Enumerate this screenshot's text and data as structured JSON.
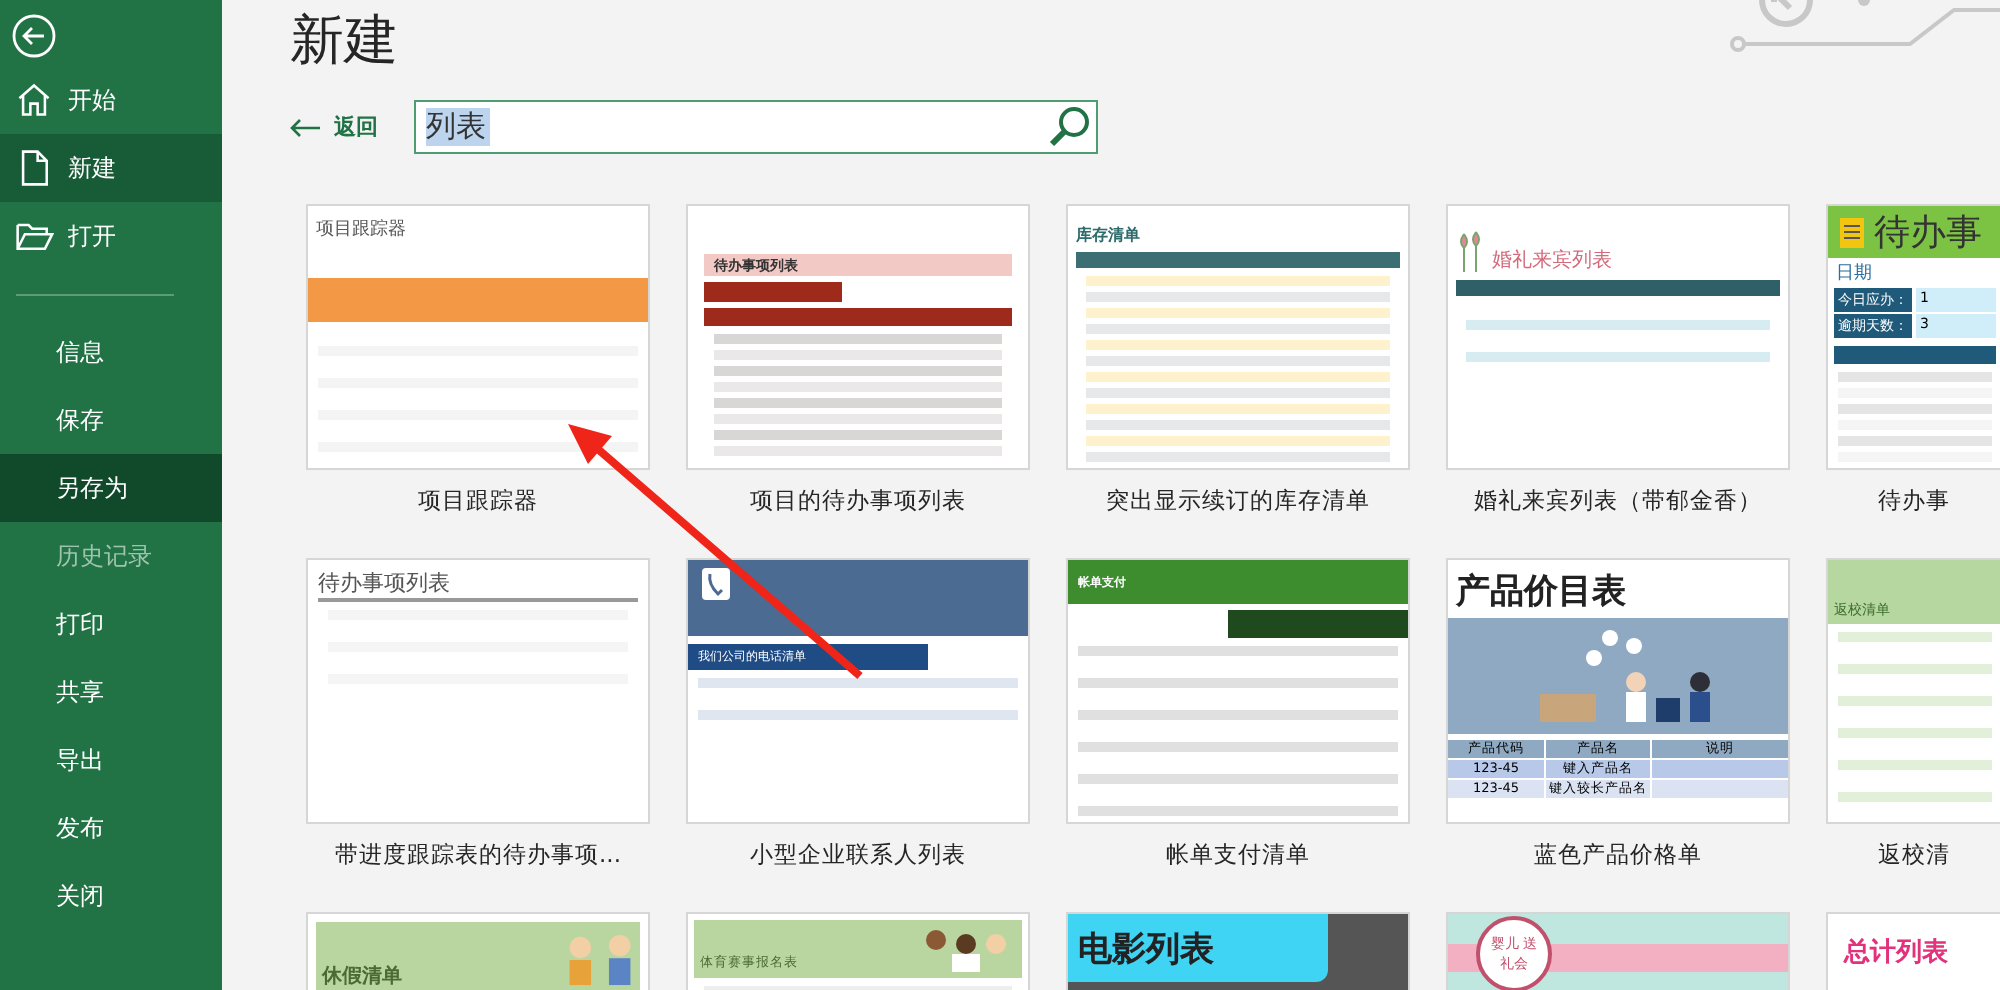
{
  "sidebar": {
    "items": [
      {
        "label": "开始",
        "selected": false,
        "hovered": false,
        "disabled": false,
        "divider_after": false
      },
      {
        "label": "新建",
        "selected": true,
        "hovered": false,
        "disabled": false,
        "divider_after": false
      },
      {
        "label": "打开",
        "selected": false,
        "hovered": false,
        "disabled": false,
        "divider_after": true
      },
      {
        "label": "信息",
        "selected": false,
        "hovered": false,
        "disabled": false,
        "divider_after": false
      },
      {
        "label": "保存",
        "selected": false,
        "hovered": false,
        "disabled": false,
        "divider_after": false
      },
      {
        "label": "另存为",
        "selected": false,
        "hovered": true,
        "disabled": false,
        "divider_after": false
      },
      {
        "label": "历史记录",
        "selected": false,
        "hovered": false,
        "disabled": true,
        "divider_after": false
      },
      {
        "label": "打印",
        "selected": false,
        "hovered": false,
        "disabled": false,
        "divider_after": false
      },
      {
        "label": "共享",
        "selected": false,
        "hovered": false,
        "disabled": false,
        "divider_after": false
      },
      {
        "label": "导出",
        "selected": false,
        "hovered": false,
        "disabled": false,
        "divider_after": false
      },
      {
        "label": "发布",
        "selected": false,
        "hovered": false,
        "disabled": false,
        "divider_after": false
      },
      {
        "label": "关闭",
        "selected": false,
        "hovered": false,
        "disabled": false,
        "divider_after": false
      }
    ]
  },
  "page_title": "新建",
  "back_link": "返回",
  "search": {
    "value": "列表"
  },
  "templates": [
    {
      "label": "项目跟踪器",
      "preview": {
        "kind": "tracker",
        "title": "项目跟踪器"
      }
    },
    {
      "label": "项目的待办事项列表",
      "preview": {
        "kind": "redlist",
        "title": "待办事项列表"
      }
    },
    {
      "label": "突出显示续订的库存清单",
      "preview": {
        "kind": "inventory",
        "title": "库存清单"
      }
    },
    {
      "label": "婚礼来宾列表（带郁金香）",
      "preview": {
        "kind": "wedding",
        "title": "婚礼来宾列表"
      }
    },
    {
      "label": "待办事",
      "preview": {
        "kind": "todo",
        "title": "待办事",
        "date_label": "日期",
        "rows": [
          {
            "label": "今日应办：",
            "value": "1"
          },
          {
            "label": "逾期天数：",
            "value": "3"
          }
        ]
      }
    },
    {
      "label": "带进度跟踪表的待办事项...",
      "preview": {
        "kind": "progress",
        "title": "待办事项列表"
      }
    },
    {
      "label": "小型企业联系人列表",
      "preview": {
        "kind": "contacts",
        "title": "我们公司的电话清单"
      }
    },
    {
      "label": "帐单支付清单",
      "preview": {
        "kind": "bills",
        "title": "帐单支付"
      }
    },
    {
      "label": "蓝色产品价格单",
      "preview": {
        "kind": "price",
        "title": "产品价目表",
        "columns": [
          "产品代码",
          "产品名",
          "说明"
        ],
        "rows": [
          [
            "123-45",
            "键入产品名"
          ],
          [
            "123-45",
            "键入较长产品名"
          ]
        ]
      }
    },
    {
      "label": "返校清",
      "preview": {
        "kind": "school",
        "title": "返校清单"
      }
    },
    {
      "preview": {
        "kind": "vacation",
        "title": "休假清单"
      }
    },
    {
      "preview": {
        "kind": "sports",
        "title": "体育赛事报名表"
      }
    },
    {
      "preview": {
        "kind": "movie",
        "title": "电影列表"
      }
    },
    {
      "preview": {
        "kind": "baby",
        "title": "婴儿 送礼会"
      }
    },
    {
      "preview": {
        "kind": "total",
        "title": "总计列表"
      }
    }
  ]
}
